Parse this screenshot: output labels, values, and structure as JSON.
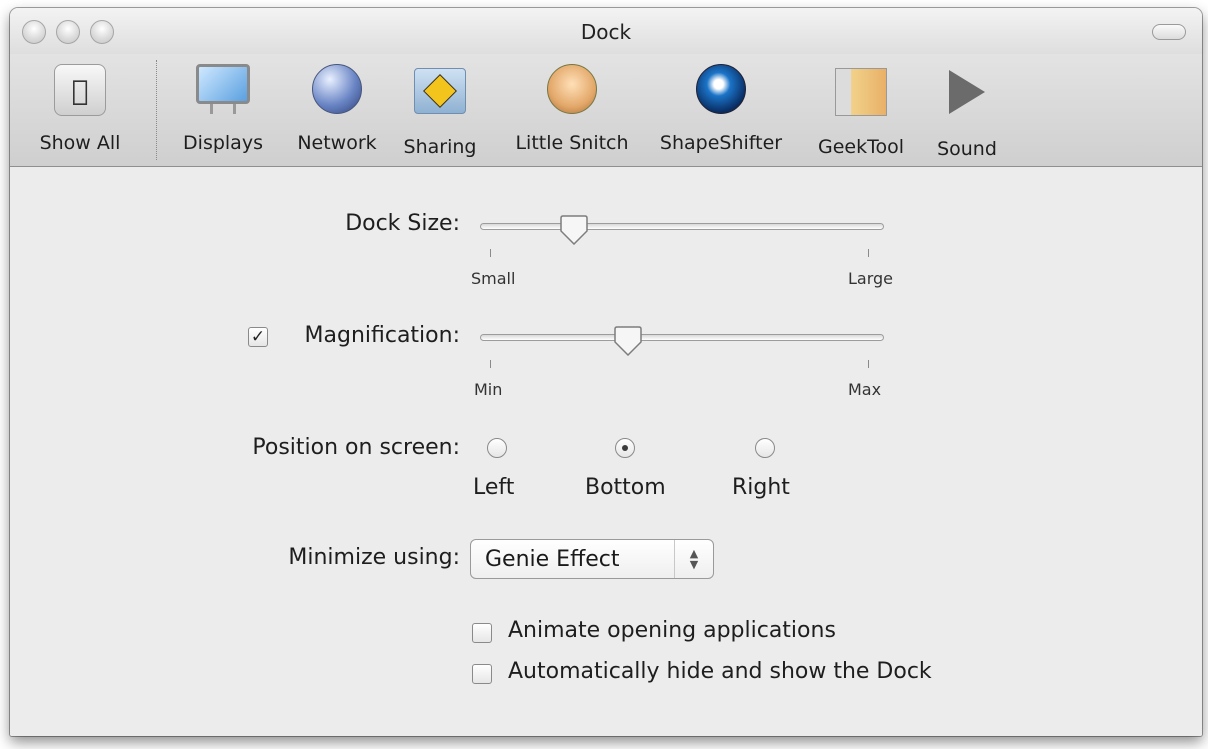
{
  "window": {
    "title": "Dock"
  },
  "toolbar": {
    "items": [
      {
        "label": "Show All",
        "icon": "apple-icon"
      },
      {
        "label": "Displays",
        "icon": "display-icon"
      },
      {
        "label": "Network",
        "icon": "globe-icon"
      },
      {
        "label": "Sharing",
        "icon": "sharing-folder-icon"
      },
      {
        "label": "Little Snitch",
        "icon": "little-snitch-icon"
      },
      {
        "label": "ShapeShifter",
        "icon": "shapeshifter-icon"
      },
      {
        "label": "GeekTool",
        "icon": "geektool-icon"
      },
      {
        "label": "Sound",
        "icon": "speaker-icon"
      }
    ]
  },
  "dock_size": {
    "label": "Dock Size:",
    "min_label": "Small",
    "max_label": "Large",
    "value": 0.22
  },
  "magnification": {
    "label": "Magnification:",
    "checked": true,
    "min_label": "Min",
    "max_label": "Max",
    "value": 0.36
  },
  "position": {
    "label": "Position on screen:",
    "options": [
      "Left",
      "Bottom",
      "Right"
    ],
    "selected": "Bottom"
  },
  "minimize": {
    "label": "Minimize using:",
    "value": "Genie Effect"
  },
  "options": {
    "animate_label": "Animate opening applications",
    "animate_checked": false,
    "autohide_label": "Automatically hide and show the Dock",
    "autohide_checked": false
  }
}
